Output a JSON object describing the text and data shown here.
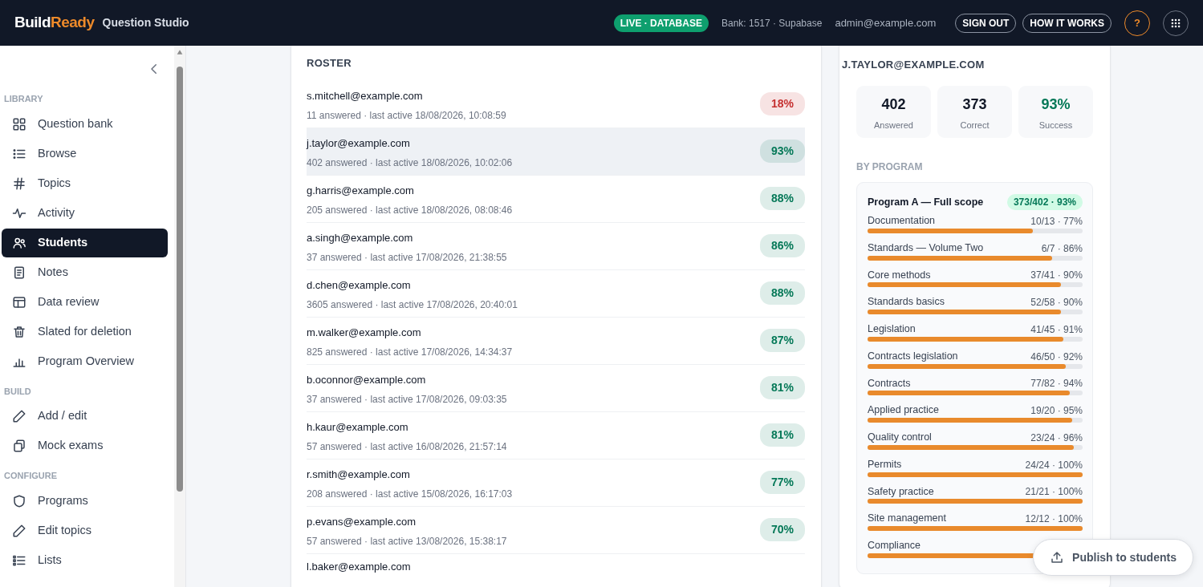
{
  "header": {
    "brand_first": "Build",
    "brand_second": "Ready",
    "product": "Question Studio",
    "live_badge": "LIVE · DATABASE",
    "bank": "Bank: 1517 · Supabase",
    "user": "admin@example.com",
    "sign_out": "SIGN OUT",
    "how_it_works": "HOW IT WORKS",
    "help": "?"
  },
  "sidebar": {
    "sections": [
      {
        "title": "LIBRARY",
        "items": [
          {
            "label": "Question bank",
            "selected": false
          },
          {
            "label": "Browse",
            "selected": false
          },
          {
            "label": "Topics",
            "selected": false
          },
          {
            "label": "Activity",
            "selected": false
          },
          {
            "label": "Students",
            "selected": true
          },
          {
            "label": "Notes",
            "selected": false
          },
          {
            "label": "Data review",
            "selected": false
          },
          {
            "label": "Slated for deletion",
            "selected": false
          },
          {
            "label": "Program Overview",
            "selected": false
          }
        ]
      },
      {
        "title": "BUILD",
        "items": [
          {
            "label": "Add / edit",
            "selected": false
          },
          {
            "label": "Mock exams",
            "selected": false
          }
        ]
      },
      {
        "title": "CONFIGURE",
        "items": [
          {
            "label": "Programs",
            "selected": false
          },
          {
            "label": "Edit topics",
            "selected": false
          },
          {
            "label": "Lists",
            "selected": false
          }
        ]
      }
    ]
  },
  "roster": {
    "title": "ROSTER",
    "rows": [
      {
        "email": "s.mitchell@example.com",
        "meta": "11 answered · last active 18/08/2026, 10:08:59",
        "score": "18%",
        "color": "#c53030",
        "selected": false
      },
      {
        "email": "j.taylor@example.com",
        "meta": "402 answered · last active 18/08/2026, 10:02:06",
        "score": "93%",
        "color": "#047857",
        "selected": true
      },
      {
        "email": "g.harris@example.com",
        "meta": "205 answered · last active 18/08/2026, 08:08:46",
        "score": "88%",
        "color": "#047857",
        "selected": false
      },
      {
        "email": "a.singh@example.com",
        "meta": "37 answered · last active 17/08/2026, 21:38:55",
        "score": "86%",
        "color": "#047857",
        "selected": false
      },
      {
        "email": "d.chen@example.com",
        "meta": "3605 answered · last active 17/08/2026, 20:40:01",
        "score": "88%",
        "color": "#047857",
        "selected": false
      },
      {
        "email": "m.walker@example.com",
        "meta": "825 answered · last active 17/08/2026, 14:34:37",
        "score": "87%",
        "color": "#047857",
        "selected": false
      },
      {
        "email": "b.oconnor@example.com",
        "meta": "37 answered · last active 17/08/2026, 09:03:35",
        "score": "81%",
        "color": "#047857",
        "selected": false
      },
      {
        "email": "h.kaur@example.com",
        "meta": "57 answered · last active 16/08/2026, 21:57:14",
        "score": "81%",
        "color": "#047857",
        "selected": false
      },
      {
        "email": "r.smith@example.com",
        "meta": "208 answered · last active 15/08/2026, 16:17:03",
        "score": "77%",
        "color": "#047857",
        "selected": false
      },
      {
        "email": "p.evans@example.com",
        "meta": "57 answered · last active 13/08/2026, 15:38:17",
        "score": "70%",
        "color": "#047857",
        "selected": false
      },
      {
        "email": "l.baker@example.com",
        "selected": false
      }
    ]
  },
  "detail": {
    "title": "J.TAYLOR@EXAMPLE.COM",
    "stats": [
      {
        "value": "402",
        "label": "Answered",
        "color": "#111827"
      },
      {
        "value": "373",
        "label": "Correct",
        "color": "#111827"
      },
      {
        "value": "93%",
        "label": "Success",
        "color": "#047857"
      }
    ],
    "by_program_title": "BY PROGRAM",
    "program": {
      "name": "Program A — Full scope",
      "summary": "373/402 · 93%",
      "topics": [
        {
          "name": "Documentation",
          "value": "10/13 · 77%",
          "level": 0.77
        },
        {
          "name": "Standards — Volume Two",
          "value": "6/7 · 86%",
          "level": 0.86
        },
        {
          "name": "Core methods",
          "value": "37/41 · 90%",
          "level": 0.9
        },
        {
          "name": "Standards basics",
          "value": "52/58 · 90%",
          "level": 0.9
        },
        {
          "name": "Legislation",
          "value": "41/45 · 91%",
          "level": 0.91
        },
        {
          "name": "Contracts legislation",
          "value": "46/50 · 92%",
          "level": 0.92
        },
        {
          "name": "Contracts",
          "value": "77/82 · 94%",
          "level": 0.94
        },
        {
          "name": "Applied practice",
          "value": "19/20 · 95%",
          "level": 0.95
        },
        {
          "name": "Quality control",
          "value": "23/24 · 96%",
          "level": 0.96
        },
        {
          "name": "Permits",
          "value": "24/24 · 100%",
          "level": 1
        },
        {
          "name": "Safety practice",
          "value": "21/21 · 100%",
          "level": 1
        },
        {
          "name": "Site management",
          "value": "12/12 · 100%",
          "level": 1
        },
        {
          "name": "Compliance",
          "level": 1
        }
      ]
    }
  },
  "publish_button": "Publish to students"
}
